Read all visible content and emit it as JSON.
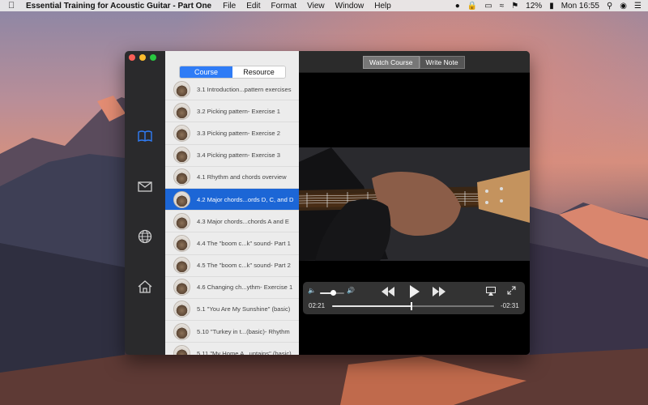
{
  "menubar": {
    "app_name": "Essential Training for Acoustic Guitar - Part One",
    "menus": [
      "File",
      "Edit",
      "Format",
      "View",
      "Window",
      "Help"
    ],
    "battery": "12%",
    "clock": "Mon 16:55"
  },
  "tabs": {
    "course": "Course",
    "resource": "Resource"
  },
  "lessons": [
    "3.1 Introduction...pattern exercises",
    "3.2 Picking pattern- Exercise 1",
    "3.3 Picking pattern- Exercise 2",
    "3.4 Picking pattern- Exercise 3",
    "4.1 Rhythm and chords overview",
    "4.2 Major chords...ords D, C, and D",
    "4.3 Major chords...chords A and E",
    "4.4 The \"boom c...k\" sound- Part 1",
    "4.5 The \"boom c...k\" sound- Part 2",
    "4.6 Changing ch...ythm- Exercise 1",
    "5.1 \"You Are My Sunshine\" (basic)",
    "5.10 \"Turkey in t...(basic)- Rhythm",
    "5.11 \"My Home A...untains\" (basic)"
  ],
  "selected_lesson": 5,
  "player_tabs": {
    "watch": "Watch Course",
    "write": "Write Note"
  },
  "controls": {
    "elapsed": "02:21",
    "remaining": "-02:31",
    "progress": 0.49,
    "volume": 0.55
  },
  "colors": {
    "accent": "#1c66d6",
    "segment_active": "#2f7cf6"
  }
}
